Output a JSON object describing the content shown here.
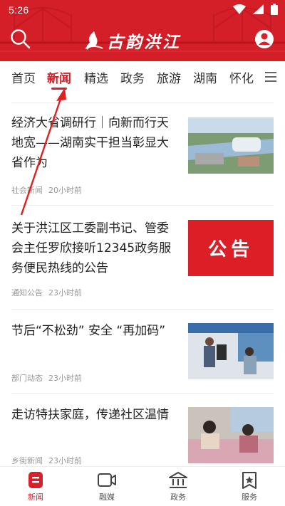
{
  "status_bar": {
    "time": "5:26"
  },
  "header": {
    "app_title": "古韵洪江",
    "background_color": "#d8202a",
    "search_icon": "search-icon",
    "profile_icon": "user-profile-icon"
  },
  "tabs": {
    "items": [
      "首页",
      "新闻",
      "精选",
      "政务",
      "旅游",
      "湖南",
      "怀化"
    ],
    "active_index": 1,
    "more_icon": "menu-lines-icon"
  },
  "news": [
    {
      "title": "经济大省调研行｜向新而行天地宽——湖南实干担当彰显大省作为",
      "category": "社会新闻",
      "time": "20小时前"
    },
    {
      "title": "关于洪江区工委副书记、管委会主任罗欣接听12345政务服务便民热线的公告",
      "category": "通知公告",
      "time": "23小时前",
      "thumb_text": "公告"
    },
    {
      "title": "节后“不松劲” 安全 “再加码”",
      "category": "部门动态",
      "time": "23小时前"
    },
    {
      "title": "走访特扶家庭，传递社区温情",
      "category": "乡街新闻",
      "time": "23小时前"
    }
  ],
  "bottom_nav": [
    {
      "label": "新闻",
      "icon": "news-icon",
      "active": true
    },
    {
      "label": "融媒",
      "icon": "video-camera-icon",
      "active": false
    },
    {
      "label": "政务",
      "icon": "government-building-icon",
      "active": false
    },
    {
      "label": "服务",
      "icon": "service-star-icon",
      "active": false
    }
  ],
  "colors": {
    "accent": "#d8202a",
    "meta_text": "#999999",
    "annotation": "#e02020"
  }
}
